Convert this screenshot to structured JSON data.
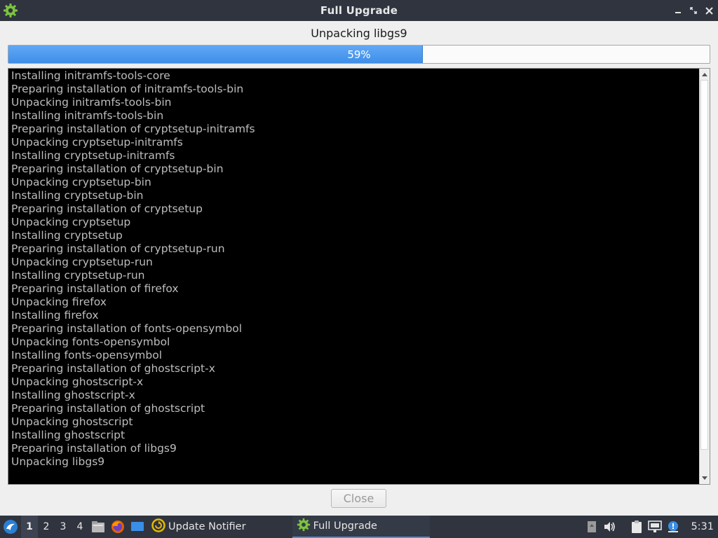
{
  "window": {
    "title": "Full Upgrade",
    "app_icon": "gear-icon"
  },
  "status": {
    "current_action": "Unpacking libgs9"
  },
  "progress": {
    "value": 59,
    "label": "59%",
    "fill_color": "#4a97ee"
  },
  "log": {
    "lines": [
      "Installing initramfs-tools-core",
      "Preparing installation of initramfs-tools-bin",
      "Unpacking initramfs-tools-bin",
      "Installing initramfs-tools-bin",
      "Preparing installation of cryptsetup-initramfs",
      "Unpacking cryptsetup-initramfs",
      "Installing cryptsetup-initramfs",
      "Preparing installation of cryptsetup-bin",
      "Unpacking cryptsetup-bin",
      "Installing cryptsetup-bin",
      "Preparing installation of cryptsetup",
      "Unpacking cryptsetup",
      "Installing cryptsetup",
      "Preparing installation of cryptsetup-run",
      "Unpacking cryptsetup-run",
      "Installing cryptsetup-run",
      "Preparing installation of firefox",
      "Unpacking firefox",
      "Installing firefox",
      "Preparing installation of fonts-opensymbol",
      "Unpacking fonts-opensymbol",
      "Installing fonts-opensymbol",
      "Preparing installation of ghostscript-x",
      "Unpacking ghostscript-x",
      "Installing ghostscript-x",
      "Preparing installation of ghostscript",
      "Unpacking ghostscript",
      "Installing ghostscript",
      "Preparing installation of libgs9",
      "Unpacking libgs9"
    ]
  },
  "buttons": {
    "close_label": "Close"
  },
  "taskbar": {
    "workspaces": [
      "1",
      "2",
      "3",
      "4"
    ],
    "active_workspace": "1",
    "tasks": [
      {
        "label": "Update Notifier",
        "icon": "update-notifier-icon"
      },
      {
        "label": "Full Upgrade",
        "icon": "gear-icon"
      }
    ],
    "clock": "5:31"
  },
  "colors": {
    "titlebar_bg": "#2f343f",
    "window_bg": "#efefef",
    "log_bg": "#000000",
    "log_text": "#bdbdbd"
  }
}
